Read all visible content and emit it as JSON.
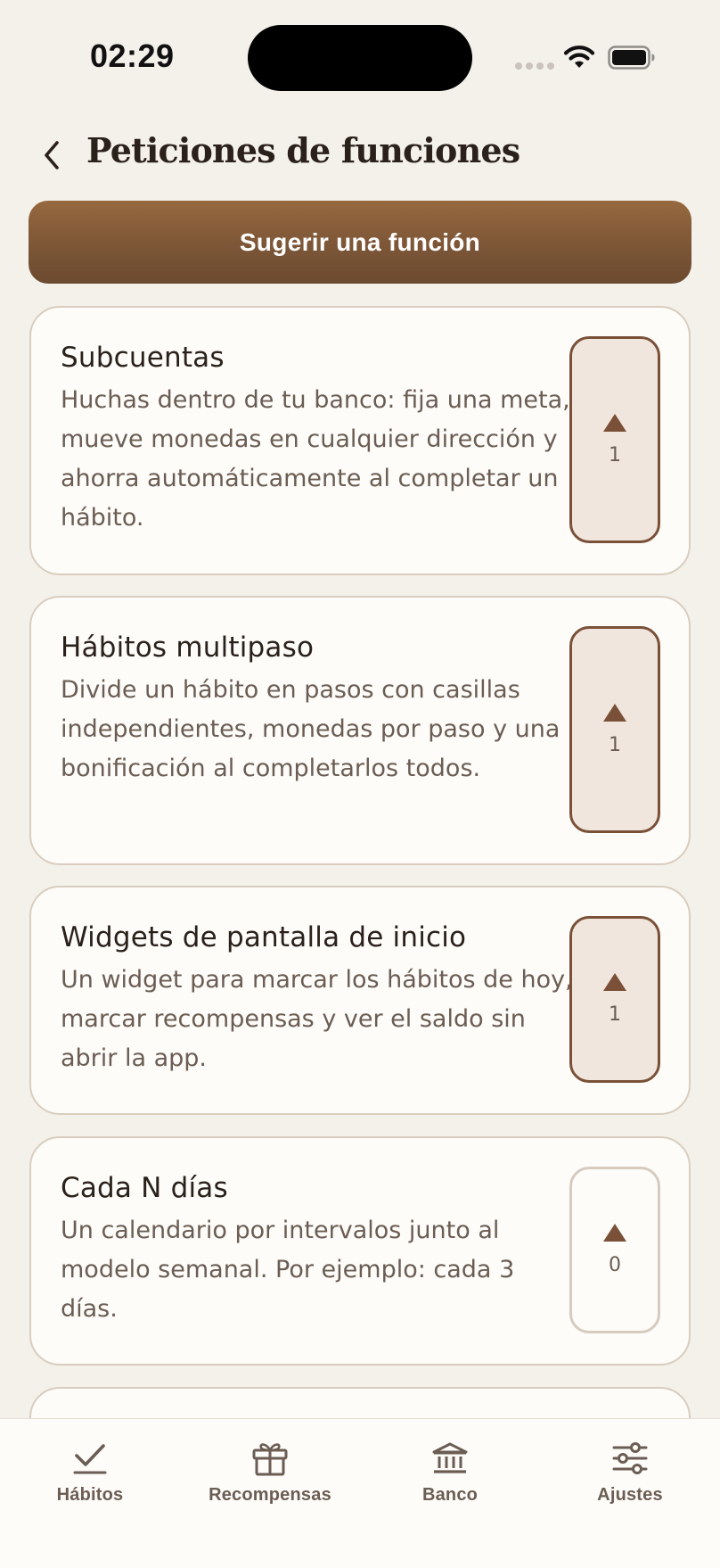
{
  "status_bar": {
    "time": "02:29"
  },
  "header": {
    "back_icon": "chevron-left-icon",
    "title": "Peticiones de funciones"
  },
  "suggest_button": {
    "label": "Sugerir una función"
  },
  "features": [
    {
      "title": "Subcuentas",
      "description": "Huchas dentro de tu banco: fija una meta, mueve monedas en cualquier dirección y ahorra automáticamente al completar un hábito.",
      "votes": "1",
      "voted": true
    },
    {
      "title": "Hábitos multipaso",
      "description": "Divide un hábito en pasos con casillas independientes, monedas por paso y una bonificación al completarlos todos.",
      "votes": "1",
      "voted": true
    },
    {
      "title": "Widgets de pantalla de inicio",
      "description": "Un widget para marcar los hábitos de hoy, marcar recompensas y ver el saldo sin abrir la app.",
      "votes": "1",
      "voted": true
    },
    {
      "title": "Cada N días",
      "description": "Un calendario por intervalos junto al modelo semanal. Por ejemplo: cada 3 días.",
      "votes": "0",
      "voted": false
    }
  ],
  "tab_bar": {
    "tabs": [
      {
        "label": "Hábitos",
        "icon": "checkmark-icon"
      },
      {
        "label": "Recompensas",
        "icon": "gift-icon"
      },
      {
        "label": "Banco",
        "icon": "bank-icon"
      },
      {
        "label": "Ajustes",
        "icon": "sliders-icon"
      }
    ]
  },
  "colors": {
    "accent": "#7a5138",
    "background": "#f4f0ea",
    "card": "#fdfcf9"
  }
}
